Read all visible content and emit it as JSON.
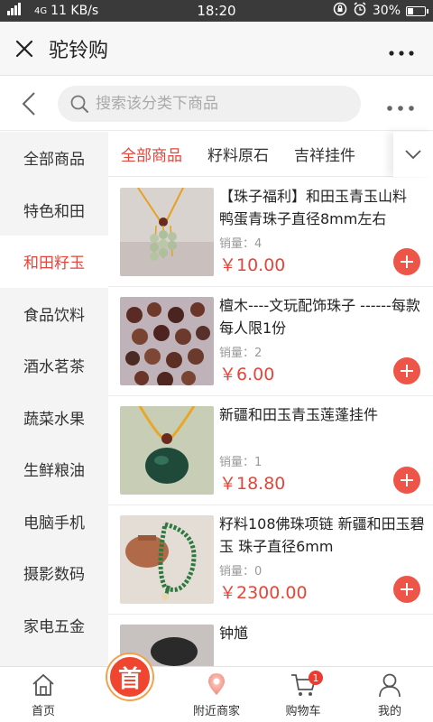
{
  "status_bar": {
    "network": "11 KB/s",
    "signal_label": "4G",
    "time": "18:20",
    "battery": "30%",
    "battery_level": 0.3
  },
  "app_bar": {
    "title": "驼铃购",
    "close_icon": "close-icon",
    "more_icon": "more-icon"
  },
  "search": {
    "placeholder": "搜索该分类下商品"
  },
  "sidebar": {
    "items": [
      {
        "label": "全部商品",
        "active": false
      },
      {
        "label": "特色和田",
        "active": false
      },
      {
        "label": "和田籽玉",
        "active": true
      },
      {
        "label": "食品饮料",
        "active": false
      },
      {
        "label": "酒水茗茶",
        "active": false
      },
      {
        "label": "蔬菜水果",
        "active": false
      },
      {
        "label": "生鲜粮油",
        "active": false
      },
      {
        "label": "电脑手机",
        "active": false
      },
      {
        "label": "摄影数码",
        "active": false
      },
      {
        "label": "家电五金",
        "active": false
      }
    ]
  },
  "tabs": {
    "items": [
      {
        "label": "全部商品",
        "active": true
      },
      {
        "label": "籽料原石",
        "active": false
      },
      {
        "label": "吉祥挂件",
        "active": false
      }
    ]
  },
  "products": {
    "sales_label": "销量：",
    "items": [
      {
        "name": "【珠子福利】和田玉青玉山料 鸭蛋青珠子直径8mm左右",
        "sales": "4",
        "price": "￥10.00",
        "image": "jade-bead-pendant"
      },
      {
        "name": "檀木----文玩配饰珠子 ------每款每人限1份",
        "sales": "2",
        "price": "￥6.00",
        "image": "wooden-beads"
      },
      {
        "name": "新疆和田玉青玉莲蓬挂件",
        "sales": "1",
        "price": "￥18.80",
        "image": "green-jade-pendant"
      },
      {
        "name": "籽料108佛珠项链 新疆和田玉碧玉 珠子直径6mm",
        "sales": "0",
        "price": "￥2300.00",
        "image": "jade-bead-necklace"
      },
      {
        "name": "钟馗",
        "sales": "",
        "price": "",
        "image": "carving"
      }
    ]
  },
  "bottom_nav": {
    "items": [
      {
        "label": "首页"
      },
      {
        "label": "",
        "badge_text": "首"
      },
      {
        "label": "附近商家"
      },
      {
        "label": "购物车",
        "badge": "1"
      },
      {
        "label": "我的"
      }
    ]
  },
  "colors": {
    "accent": "#e5453a",
    "status_bar": "#3a3a3a"
  }
}
